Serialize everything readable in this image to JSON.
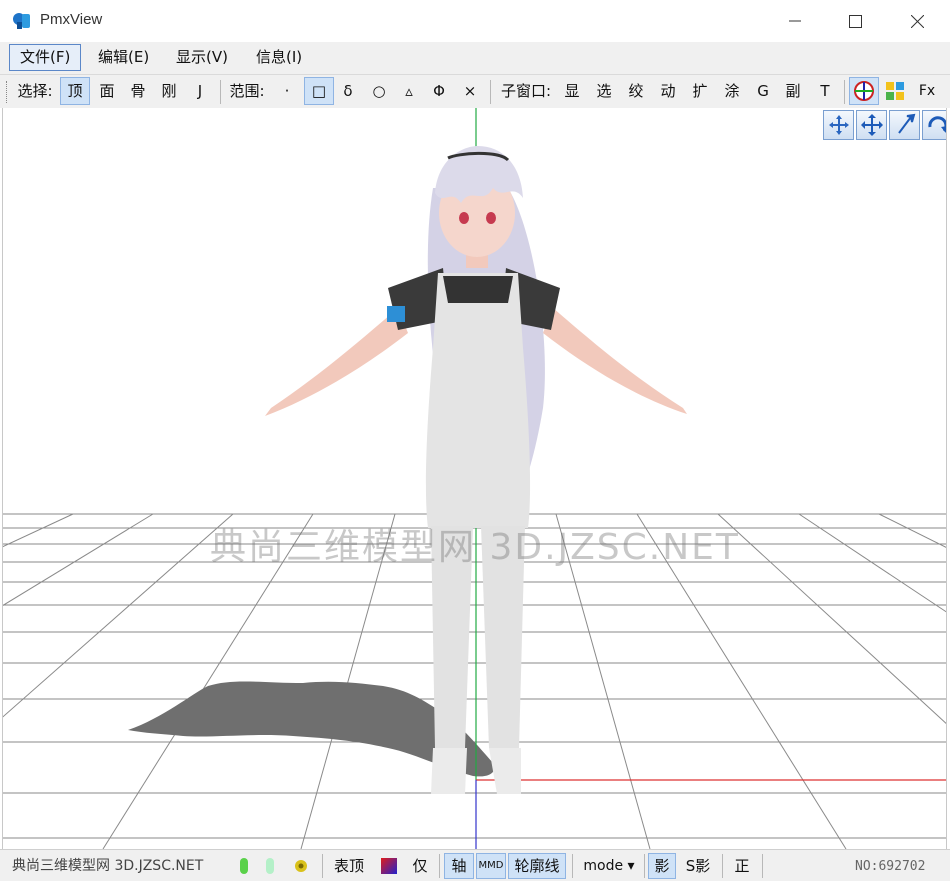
{
  "window": {
    "title": "PmxView"
  },
  "menu": [
    "文件(F)",
    "编辑(E)",
    "显示(V)",
    "信息(I)"
  ],
  "toolbar": {
    "select_label": "选择:",
    "select_items": [
      "顶",
      "面",
      "骨",
      "刚",
      "J"
    ],
    "range_label": "范围:",
    "range_items": [
      "·",
      "□",
      "δ",
      "○",
      "▵",
      "Φ",
      "×"
    ],
    "subwindow_label": "子窗口:",
    "subwindow_items": [
      "显",
      "选",
      "绞",
      "动",
      "扩",
      "涂",
      "G",
      "副",
      "T"
    ],
    "fx_label": "Fx"
  },
  "viewport": {
    "watermark": "典尚三维模型网 3D.JZSC.NET",
    "nav_icons": [
      "move-view-icon",
      "pan-icon",
      "zoom-icon",
      "rotate-icon"
    ],
    "axis_colors": {
      "y": "#22aa44",
      "x": "#dd3333",
      "z": "#3333cc"
    }
  },
  "statusbar": {
    "watermark": "典尚三维模型网 3D.JZSC.NET",
    "table_top": "表顶",
    "only": "仅",
    "axis": "轴",
    "mmd": "MMD",
    "outline": "轮廓线",
    "mode": "mode ▾",
    "shadow": "影",
    "s_shadow": "S影",
    "front": "正",
    "number": "NO:692702"
  }
}
